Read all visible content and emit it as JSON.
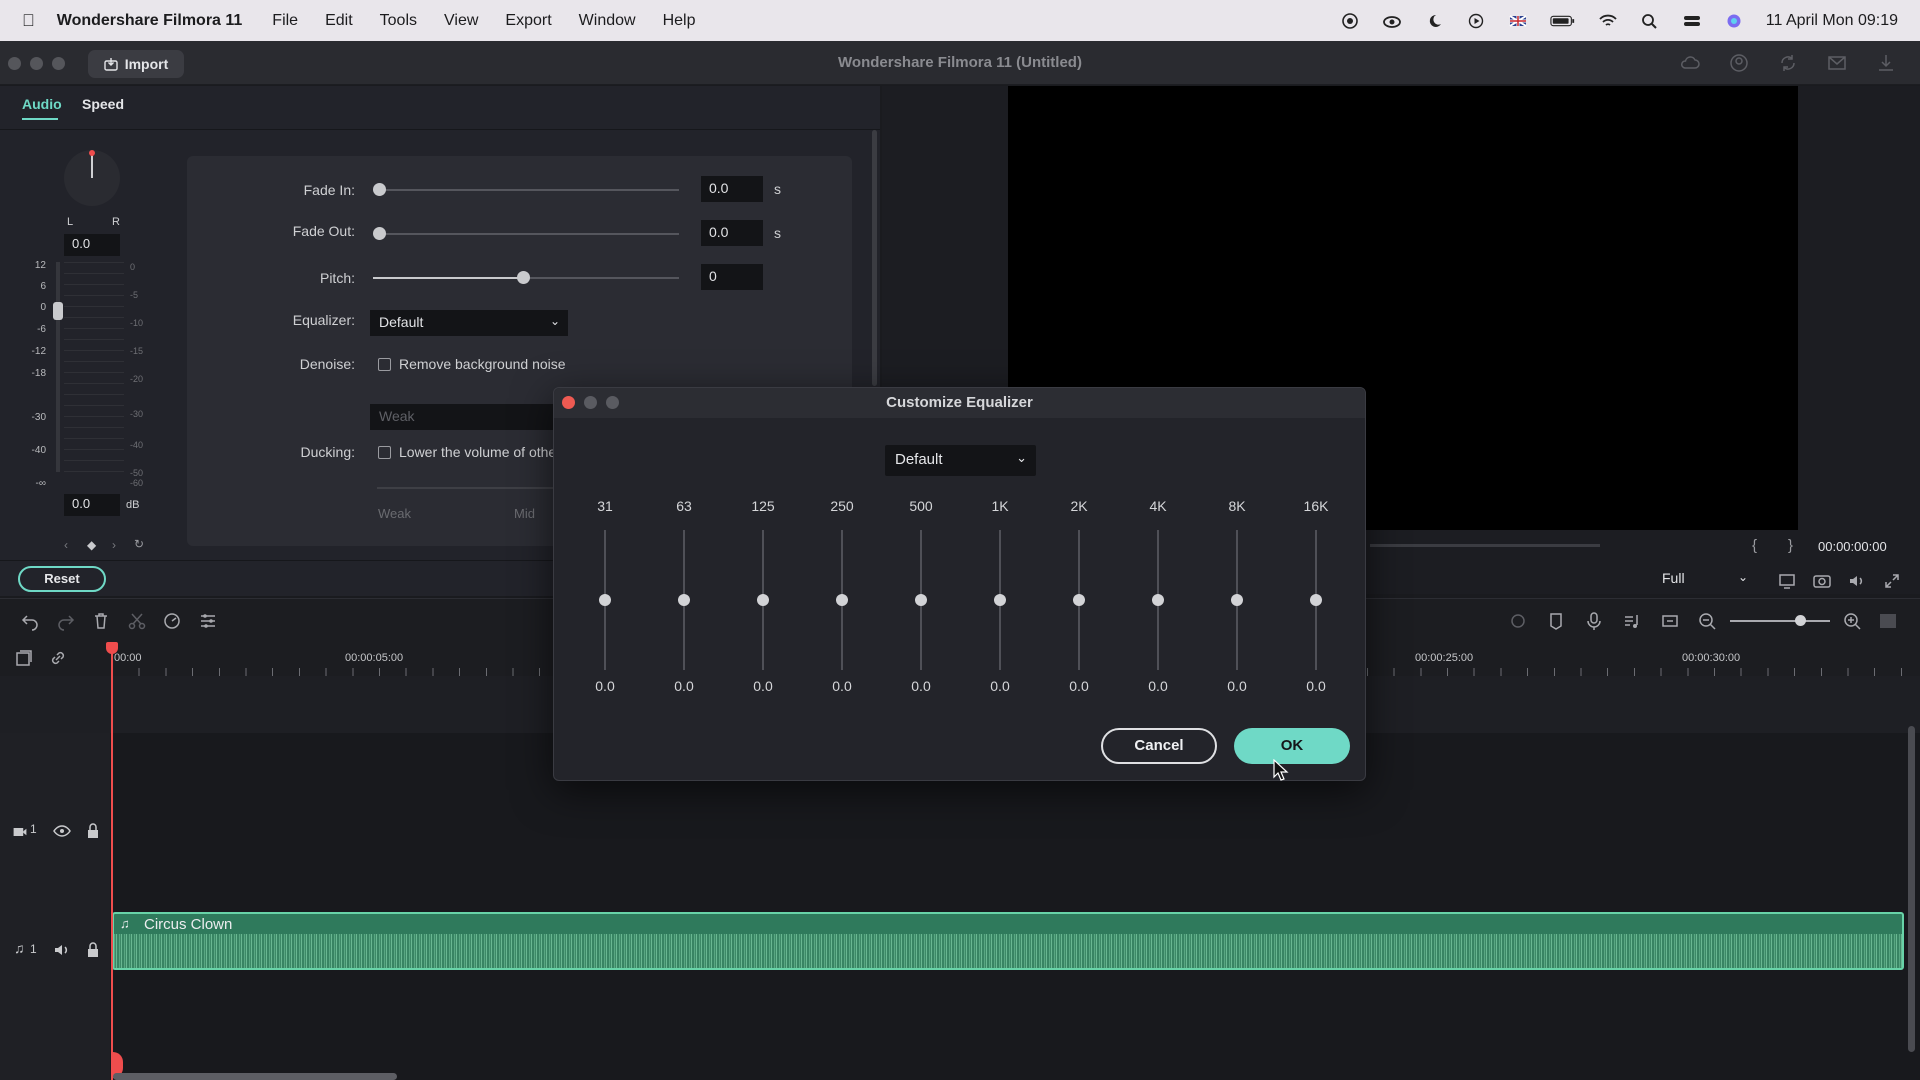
{
  "menubar": {
    "app_name": "Wondershare Filmora 11",
    "items": [
      "File",
      "Edit",
      "Tools",
      "View",
      "Export",
      "Window",
      "Help"
    ],
    "datetime": "11 April Mon  09:19"
  },
  "window": {
    "title": "Wondershare Filmora 11 (Untitled)",
    "import_label": "Import"
  },
  "panel": {
    "tabs": [
      "Audio",
      "Speed"
    ],
    "active_tab": "Audio",
    "pan_left": "L",
    "pan_right": "R",
    "pan_value": "0.0",
    "volume_value": "0.0",
    "volume_unit": "dB",
    "meter_left_ticks": [
      "12",
      "6",
      "0",
      "-6",
      "-12",
      "-18",
      "-30",
      "-40",
      "-∞"
    ],
    "meter_right_ticks": [
      "0",
      "-5",
      "-10",
      "-15",
      "-20",
      "-30",
      "-40",
      "-50",
      "-60"
    ],
    "fade_in_label": "Fade In:",
    "fade_in_value": "0.0",
    "fade_out_label": "Fade Out:",
    "fade_out_value": "0.0",
    "seconds_unit": "s",
    "pitch_label": "Pitch:",
    "pitch_value": "0",
    "equalizer_label": "Equalizer:",
    "equalizer_value": "Default",
    "denoise_label": "Denoise:",
    "denoise_checkbox": "Remove background noise",
    "denoise_level": "Weak",
    "ducking_label": "Ducking:",
    "ducking_checkbox": "Lower the volume of other",
    "ducking_weak": "Weak",
    "ducking_mid": "Mid",
    "reset_label": "Reset"
  },
  "preview": {
    "timecode": "00:00:00:00",
    "quality": "Full",
    "brace_open": "{",
    "brace_close": "}"
  },
  "timeline": {
    "ruler_labels": [
      "00:00",
      "00:00:05:00",
      "00:00:25:00",
      "00:00:30:00"
    ],
    "video_track": "1",
    "audio_track": "1",
    "clip_name": "Circus Clown"
  },
  "dialog": {
    "title": "Customize Equalizer",
    "preset": "Default",
    "bands": [
      {
        "freq": "31",
        "value": "0.0"
      },
      {
        "freq": "63",
        "value": "0.0"
      },
      {
        "freq": "125",
        "value": "0.0"
      },
      {
        "freq": "250",
        "value": "0.0"
      },
      {
        "freq": "500",
        "value": "0.0"
      },
      {
        "freq": "1K",
        "value": "0.0"
      },
      {
        "freq": "2K",
        "value": "0.0"
      },
      {
        "freq": "4K",
        "value": "0.0"
      },
      {
        "freq": "8K",
        "value": "0.0"
      },
      {
        "freq": "16K",
        "value": "0.0"
      }
    ],
    "cancel_label": "Cancel",
    "ok_label": "OK"
  },
  "colors": {
    "accent": "#6fd9c6",
    "audio_clip": "#2f7a5c",
    "playhead": "#ef4d4d"
  }
}
